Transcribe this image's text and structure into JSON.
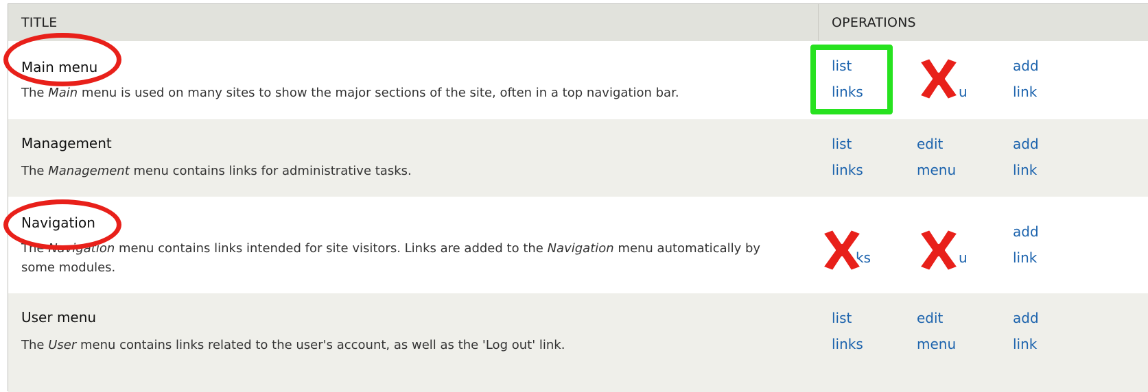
{
  "header": {
    "title": "TITLE",
    "operations": "OPERATIONS"
  },
  "menus": [
    {
      "name": "Main menu",
      "desc_pre": "The ",
      "desc_em": "Main",
      "desc_post": " menu is used on many sites to show the major sections of the site, often in a top navigation bar.",
      "ops": {
        "list": "list",
        "links": "links",
        "edit": "",
        "menu": "u",
        "add": "add",
        "link": "link"
      }
    },
    {
      "name": "Management",
      "desc_pre": "The ",
      "desc_em": "Management",
      "desc_post": " menu contains links for administrative tasks.",
      "ops": {
        "list": "list",
        "links": "links",
        "edit": "edit",
        "menu": "menu",
        "add": "add",
        "link": "link"
      }
    },
    {
      "name": "Navigation",
      "desc_pre": "The ",
      "desc_em": "Navigation",
      "desc_mid": " menu contains links intended for site visitors. Links are added to the ",
      "desc_em2": "Navigation",
      "desc_post": " menu automatically by some modules.",
      "ops": {
        "list": "",
        "links": "ks",
        "edit": "",
        "menu": "u",
        "add": "add",
        "link": "link"
      }
    },
    {
      "name": "User menu",
      "desc_pre": "The ",
      "desc_em": "User",
      "desc_post": " menu contains links related to the user's account, as well as the 'Log out' link.",
      "ops": {
        "list": "list",
        "links": "links",
        "edit": "edit",
        "menu": "menu",
        "add": "add",
        "link": "link"
      }
    }
  ],
  "annotations": {
    "ellipse_color": "#e8201a",
    "highlight_color": "#27e21f",
    "x_color": "#e8201a"
  }
}
